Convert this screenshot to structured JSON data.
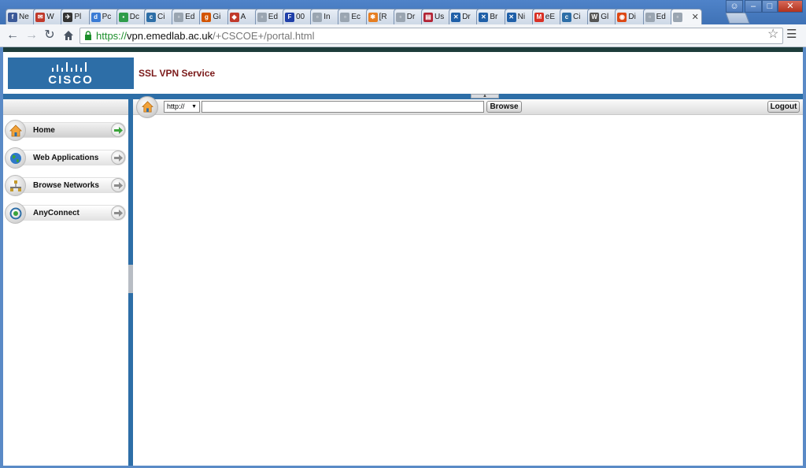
{
  "browser": {
    "tabs": [
      {
        "label": "Ne",
        "icon": "facebook-icon",
        "color": "#3b5998",
        "glyph": "f"
      },
      {
        "label": "W",
        "icon": "mail-icon",
        "color": "#c0392b",
        "glyph": "✉"
      },
      {
        "label": "Pl",
        "icon": "plane-icon",
        "color": "#333333",
        "glyph": "✈"
      },
      {
        "label": "Pc",
        "icon": "dell-icon",
        "color": "#3a7bd5",
        "glyph": "d"
      },
      {
        "label": "Dc",
        "icon": "doc-green-icon",
        "color": "#2e9c4a",
        "glyph": "▪"
      },
      {
        "label": "Ci",
        "icon": "cisco-icon",
        "color": "#2d6ea7",
        "glyph": "c"
      },
      {
        "label": "Ed",
        "icon": "page-icon",
        "color": "#9aa5b1",
        "glyph": "▫"
      },
      {
        "label": "Gi",
        "icon": "gift-icon",
        "color": "#d35400",
        "glyph": "g"
      },
      {
        "label": "A",
        "icon": "shield-icon",
        "color": "#c0392b",
        "glyph": "◆"
      },
      {
        "label": "Ed",
        "icon": "page-icon",
        "color": "#9aa5b1",
        "glyph": "▫"
      },
      {
        "label": "00",
        "icon": "ft-icon",
        "color": "#1f3fa8",
        "glyph": "F"
      },
      {
        "label": "In",
        "icon": "page-icon",
        "color": "#9aa5b1",
        "glyph": "▫"
      },
      {
        "label": "Ec",
        "icon": "page-icon",
        "color": "#9aa5b1",
        "glyph": "▫"
      },
      {
        "label": "[R",
        "icon": "pinwheel-icon",
        "color": "#e67e22",
        "glyph": "✱"
      },
      {
        "label": "Dr",
        "icon": "page-icon",
        "color": "#9aa5b1",
        "glyph": "▫"
      },
      {
        "label": "Us",
        "icon": "flag-icon",
        "color": "#b22234",
        "glyph": "▤"
      },
      {
        "label": "Dr",
        "icon": "x-icon",
        "color": "#1f5fa8",
        "glyph": "✕"
      },
      {
        "label": "Br",
        "icon": "x-icon",
        "color": "#1f5fa8",
        "glyph": "✕"
      },
      {
        "label": "Ni",
        "icon": "x-icon",
        "color": "#1f5fa8",
        "glyph": "✕"
      },
      {
        "label": "eE",
        "icon": "gmail-icon",
        "color": "#d93025",
        "glyph": "M"
      },
      {
        "label": "Ci",
        "icon": "cisco-icon",
        "color": "#2d6ea7",
        "glyph": "c"
      },
      {
        "label": "Gl",
        "icon": "wikipedia-icon",
        "color": "#555555",
        "glyph": "W"
      },
      {
        "label": "Di",
        "icon": "ubuntu-icon",
        "color": "#dd4814",
        "glyph": "◉"
      },
      {
        "label": "Ed",
        "icon": "page-icon",
        "color": "#9aa5b1",
        "glyph": "▫"
      },
      {
        "label": "",
        "icon": "page-icon",
        "color": "#9aa5b1",
        "glyph": "▫",
        "active": true
      }
    ],
    "url": {
      "scheme": "https://",
      "host": "vpn.emedlab.ac.uk",
      "path": "/+CSCOE+/portal.html"
    }
  },
  "header": {
    "logo_text": "CISCO",
    "service_title": "SSL VPN Service"
  },
  "sidebar": {
    "items": [
      {
        "label": "Home",
        "icon": "home-icon",
        "active": true
      },
      {
        "label": "Web Applications",
        "icon": "globe-icon"
      },
      {
        "label": "Browse Networks",
        "icon": "network-icon"
      },
      {
        "label": "AnyConnect",
        "icon": "anyconnect-icon"
      }
    ]
  },
  "addressbar": {
    "protocol": "http://",
    "url_value": "",
    "browse_label": "Browse",
    "logout_label": "Logout"
  },
  "colors": {
    "brand_blue": "#2d6ea7",
    "title_red": "#7b1a1a",
    "secure_green": "#1c8f2b"
  }
}
